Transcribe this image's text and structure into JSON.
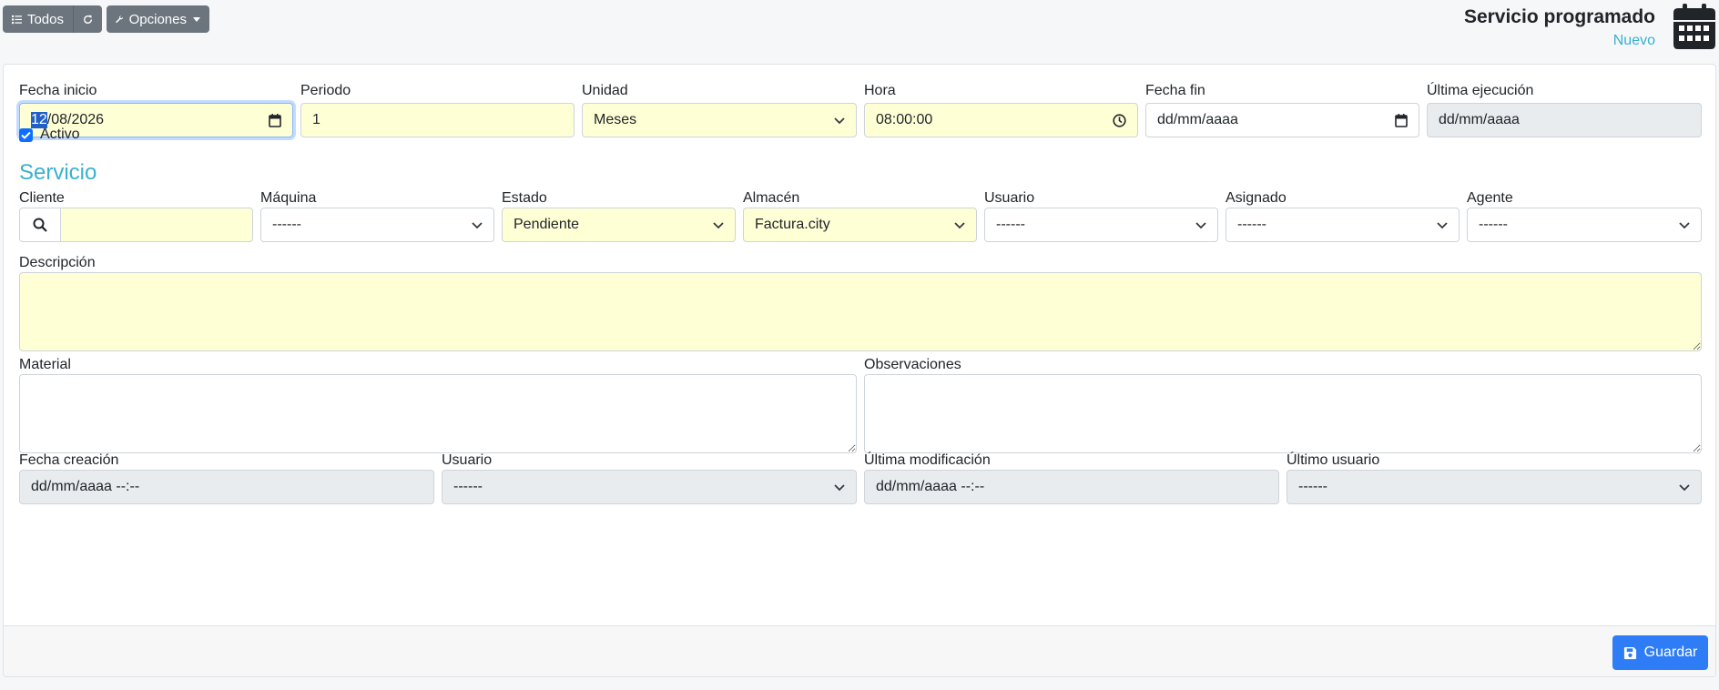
{
  "toolbar": {
    "all_label": "Todos",
    "options_label": "Opciones"
  },
  "header": {
    "title": "Servicio programado",
    "subtitle": "Nuevo"
  },
  "schedule": {
    "start_date": {
      "label": "Fecha inicio",
      "value_selected": "12",
      "value_rest": "/08/2026"
    },
    "period": {
      "label": "Periodo",
      "value": "1"
    },
    "unit": {
      "label": "Unidad",
      "value": "Meses"
    },
    "time": {
      "label": "Hora",
      "value": "08:00:00"
    },
    "end_date": {
      "label": "Fecha fin",
      "value": "dd/mm/aaaa"
    },
    "last_run": {
      "label": "Última ejecución",
      "value": "dd/mm/aaaa"
    },
    "active": {
      "label": "Activo",
      "checked": true
    }
  },
  "service": {
    "section_title": "Servicio",
    "client": {
      "label": "Cliente",
      "value": ""
    },
    "machine": {
      "label": "Máquina",
      "value": "------"
    },
    "status": {
      "label": "Estado",
      "value": "Pendiente"
    },
    "warehouse": {
      "label": "Almacén",
      "value": "Factura.city"
    },
    "user": {
      "label": "Usuario",
      "value": "------"
    },
    "assigned": {
      "label": "Asignado",
      "value": "------"
    },
    "agent": {
      "label": "Agente",
      "value": "------"
    },
    "description": {
      "label": "Descripción",
      "value": ""
    },
    "material": {
      "label": "Material",
      "value": ""
    },
    "observations": {
      "label": "Observaciones",
      "value": ""
    }
  },
  "audit": {
    "created": {
      "label": "Fecha creación",
      "value": "dd/mm/aaaa --:--"
    },
    "created_user": {
      "label": "Usuario",
      "value": "------"
    },
    "modified": {
      "label": "Última modificación",
      "value": "dd/mm/aaaa --:--"
    },
    "modified_user": {
      "label": "Último usuario",
      "value": "------"
    }
  },
  "footer": {
    "save_label": "Guardar"
  },
  "colors": {
    "accent": "#3bb0cf",
    "required_bg": "#ffffd6",
    "save_button": "#2f7df6",
    "toolbar_button": "#6c757d"
  }
}
